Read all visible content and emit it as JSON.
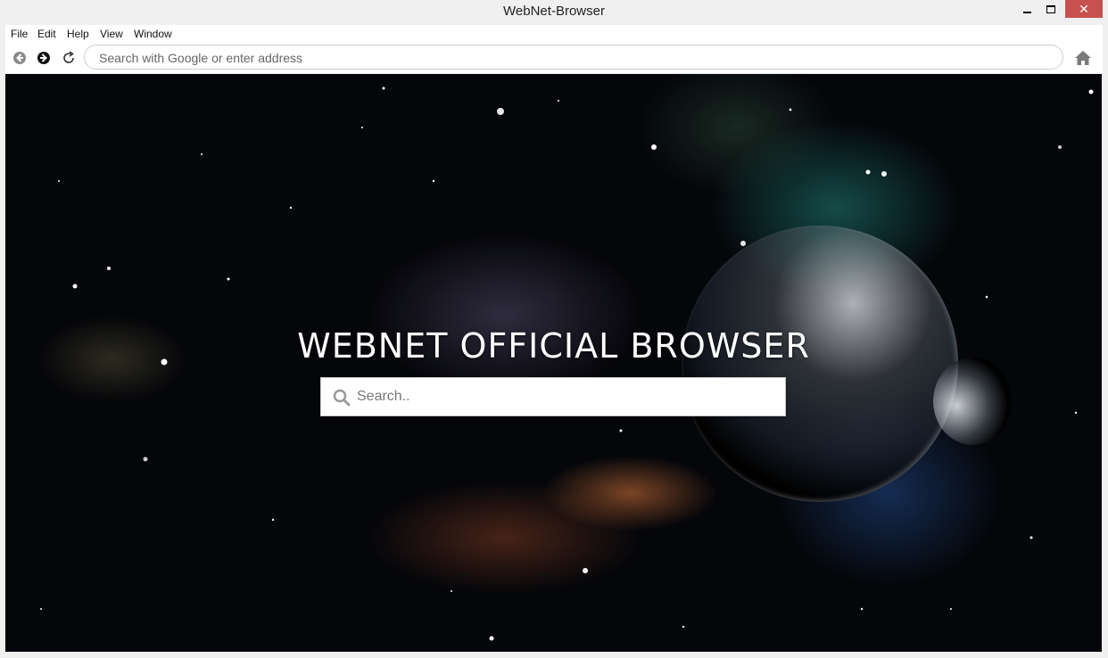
{
  "window": {
    "title": "WebNet-Browser",
    "close_glyph": "✕"
  },
  "menu": {
    "items": [
      "File",
      "Edit",
      "Help",
      "View",
      "Window"
    ]
  },
  "navbar": {
    "address_placeholder": "Search with Google or enter address",
    "icons": [
      "back-arrow-icon",
      "forward-arrow-icon",
      "reload-icon",
      "home-icon"
    ]
  },
  "page": {
    "headline": "WEBNET OFFICIAL BROWSER",
    "search_placeholder": "Search.."
  },
  "colors": {
    "close_button": "#c7514e",
    "window_chrome": "#f0f0f0",
    "page_background": "#05060a"
  }
}
